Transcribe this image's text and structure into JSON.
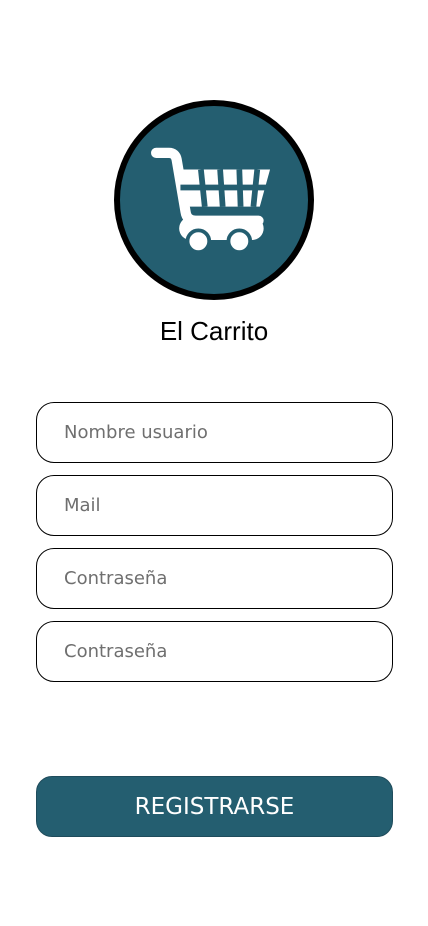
{
  "colors": {
    "brand": "#245e70",
    "logo_border": "#000000",
    "icon": "#ffffff"
  },
  "logo": {
    "icon": "shopping-cart-icon"
  },
  "app": {
    "name": "El Carrito"
  },
  "form": {
    "username": {
      "placeholder": "Nombre usuario",
      "value": ""
    },
    "email": {
      "placeholder": "Mail",
      "value": ""
    },
    "password": {
      "placeholder": "Contraseña",
      "value": ""
    },
    "password_confirm": {
      "placeholder": "Contraseña",
      "value": ""
    }
  },
  "actions": {
    "register_label": "REGISTRARSE"
  }
}
